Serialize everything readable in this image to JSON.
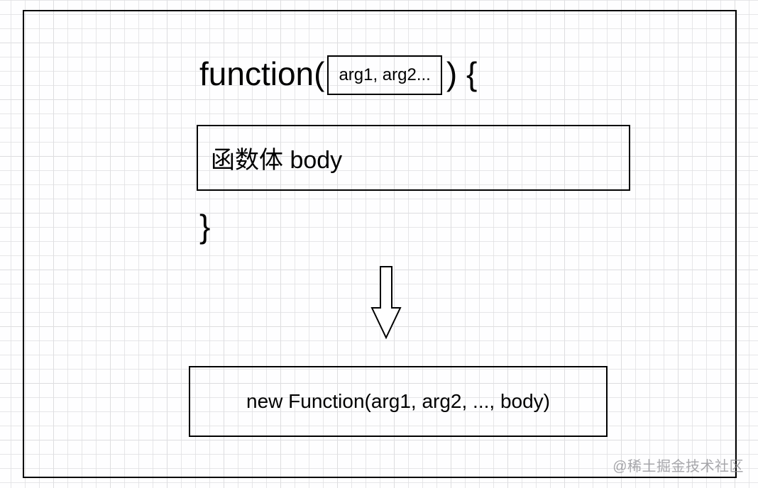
{
  "diagram": {
    "line1": {
      "prefix": "function(",
      "args": "arg1, arg2...",
      "suffix": ") {"
    },
    "body_box": "函数体 body",
    "close_brace": "}",
    "result_box": "new Function(arg1, arg2, ..., body)"
  },
  "watermark": "@稀土掘金技术社区"
}
